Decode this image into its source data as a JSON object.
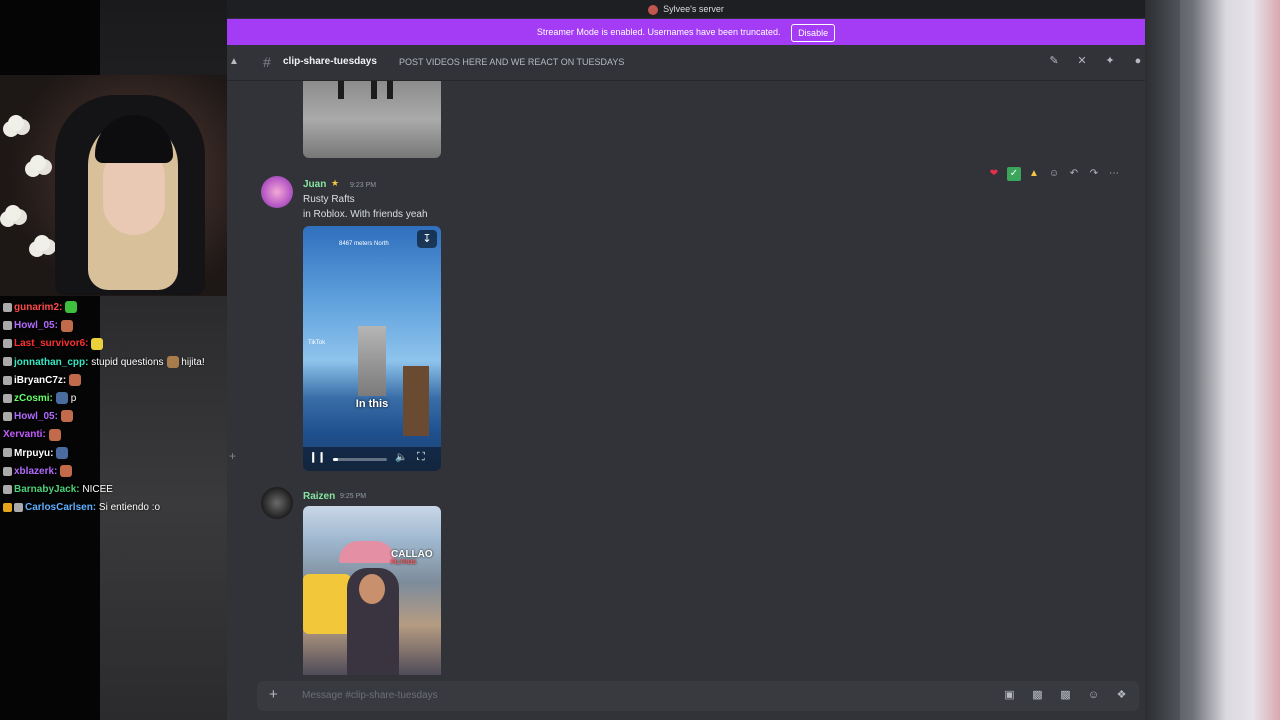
{
  "server_title": "Sylvee's server",
  "banner": {
    "text": "Streamer Mode is enabled. Usernames have been truncated.",
    "button": "Disable"
  },
  "channel": {
    "name": "clip-share-tuesdays",
    "topic": "POST VIDEOS HERE AND WE REACT ON TUESDAYS"
  },
  "messages": [
    {
      "author": "Juan",
      "time": "9:23 PM",
      "lines": [
        "Rusty Rafts",
        "in Roblox. With friends yeah"
      ],
      "video": {
        "caption": "In this",
        "top_caption": "8467 meters North",
        "watermark": "TikTok",
        "progress": 0.1
      }
    },
    {
      "author": "Raizen",
      "time": "9:25 PM",
      "image_label": "CALLAO",
      "image_sublabel": "FILTROS"
    }
  ],
  "composer": {
    "placeholder": "Message #clip-share-tuesdays"
  },
  "chat": [
    {
      "user": "gunarim2:",
      "color": "#ff4b4b",
      "msg": ""
    },
    {
      "user": "Howl_05:",
      "color": "#b36bff",
      "msg": ""
    },
    {
      "user": "Last_survivor6:",
      "color": "#ff3030",
      "msg": ""
    },
    {
      "user": "jonnathan_cpp:",
      "color": "#37e8c4",
      "msg": "stupid questions",
      "msg2": "hijita!"
    },
    {
      "user": "iBryanC7z:",
      "color": "#ffffff",
      "msg": ""
    },
    {
      "user": "zCosmi:",
      "color": "#66ff66",
      "msg": "p"
    },
    {
      "user": "Howl_05:",
      "color": "#b36bff",
      "msg": ""
    },
    {
      "user": "Xervanti:",
      "color": "#c35cff",
      "msg": ""
    },
    {
      "user": "Mrpuyu:",
      "color": "#ffffff",
      "msg": ""
    },
    {
      "user": "xblazerk:",
      "color": "#b36bff",
      "msg": ""
    },
    {
      "user": "BarnabyJack:",
      "color": "#4ed17a",
      "msg": "NICEE"
    },
    {
      "user": "CarlosCarlsen:",
      "color": "#5fb0ff",
      "msg": "Si entiendo :o"
    }
  ]
}
